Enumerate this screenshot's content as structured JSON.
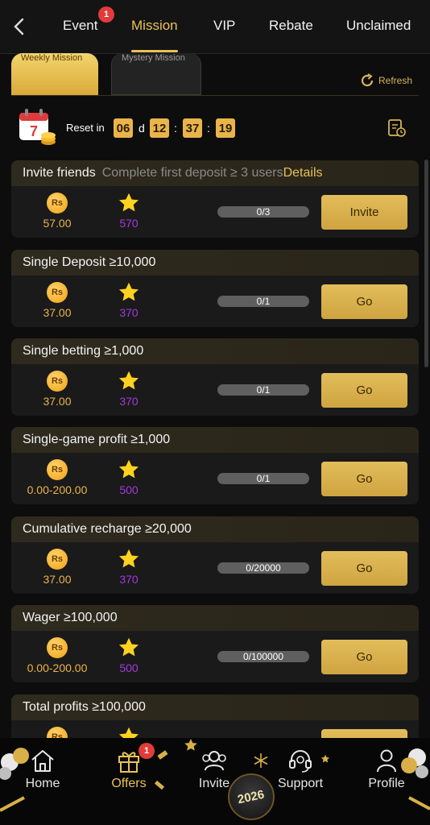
{
  "nav": {
    "tabs": [
      {
        "label": "Event",
        "badge": "1"
      },
      {
        "label": "Mission"
      },
      {
        "label": "VIP"
      },
      {
        "label": "Rebate"
      },
      {
        "label": "Unclaimed"
      }
    ],
    "active": "Mission"
  },
  "mission_tabs": {
    "weekly": "Weekly Mission",
    "mystery": "Mystery Mission"
  },
  "refresh_label": "Refresh",
  "reset": {
    "label": "Reset in",
    "calendar_day": "7",
    "days": "06",
    "days_unit": "d",
    "hours": "12",
    "minutes": "37",
    "seconds": "19",
    "sep": ":"
  },
  "missions": [
    {
      "title": "Invite friends",
      "desc": "Complete first deposit ≥ 3 users",
      "details": "Details",
      "reward": "57.00",
      "points": "570",
      "progress": "0/3",
      "button": "Invite"
    },
    {
      "title": "Single Deposit ≥10,000",
      "reward": "37.00",
      "points": "370",
      "progress": "0/1",
      "button": "Go"
    },
    {
      "title": "Single betting ≥1,000",
      "reward": "37.00",
      "points": "370",
      "progress": "0/1",
      "button": "Go"
    },
    {
      "title": "Single-game profit ≥1,000",
      "reward": "0.00-200.00",
      "points": "500",
      "progress": "0/1",
      "button": "Go"
    },
    {
      "title": "Cumulative recharge ≥20,000",
      "reward": "37.00",
      "points": "370",
      "progress": "0/20000",
      "button": "Go"
    },
    {
      "title": "Wager ≥100,000",
      "reward": "0.00-200.00",
      "points": "500",
      "progress": "0/100000",
      "button": "Go"
    },
    {
      "title": "Total profits ≥100,000"
    }
  ],
  "currency_symbol": "Rs",
  "bottom_nav": {
    "items": [
      {
        "label": "Home",
        "icon": "home-icon"
      },
      {
        "label": "Offers",
        "icon": "gift-icon",
        "badge": "1"
      },
      {
        "label": "Invite",
        "icon": "users-icon"
      },
      {
        "label": "Support",
        "icon": "headset-icon"
      },
      {
        "label": "Profile",
        "icon": "person-icon"
      }
    ],
    "active": "Offers",
    "emblem": "2026"
  },
  "colors": {
    "accent": "#e8c15b",
    "points": "#a23ae0",
    "badge": "#e23b3b"
  }
}
